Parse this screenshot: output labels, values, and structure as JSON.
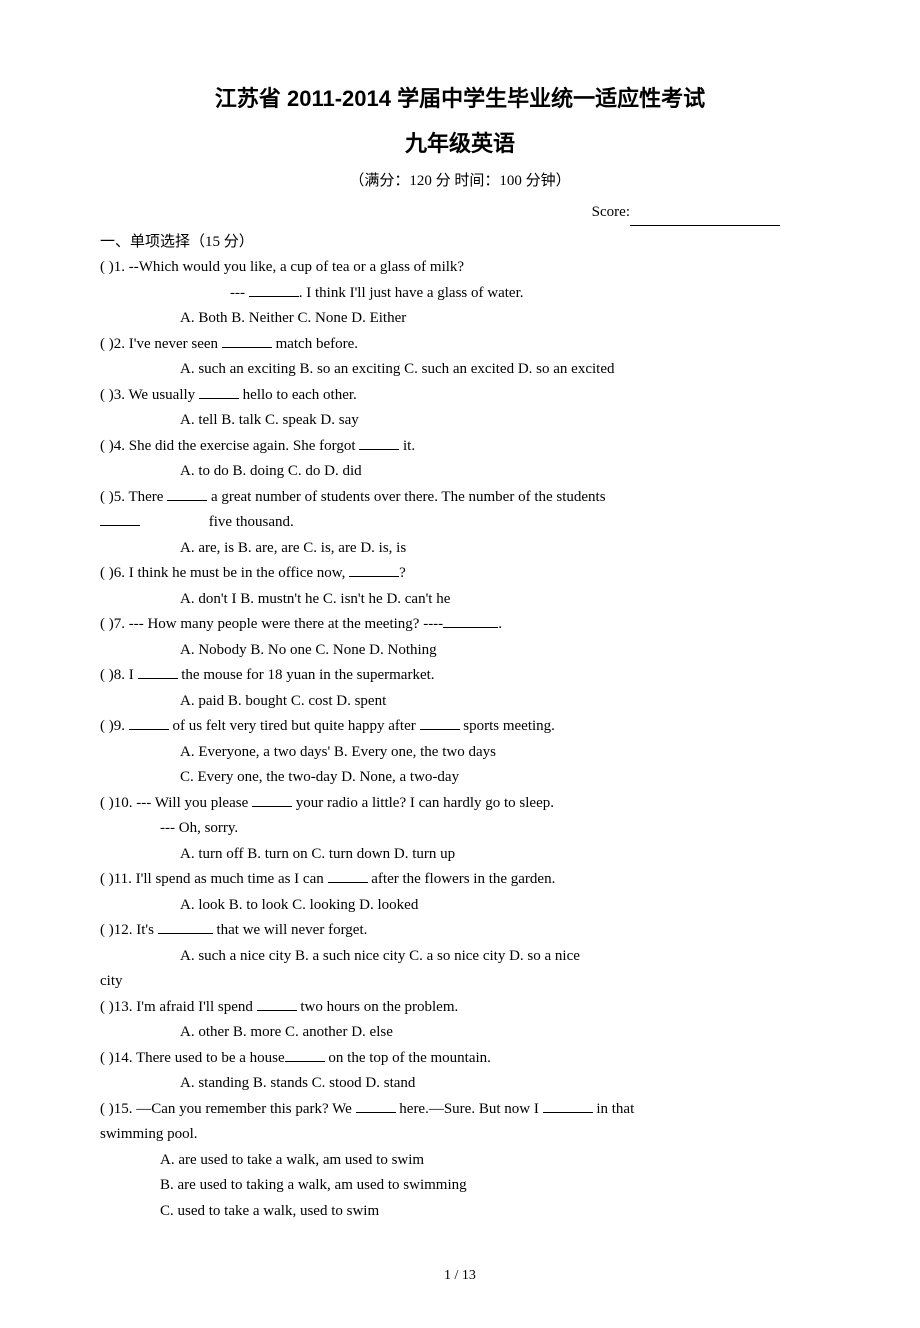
{
  "header": {
    "title1": "江苏省 2011-2014 学届中学生毕业统一适应性考试",
    "title2": "九年级英语",
    "subtitle": "（满分：120 分  时间：100 分钟）",
    "score_label": "Score:"
  },
  "section1": {
    "header": "一、单项选择（15 分）"
  },
  "q1": {
    "stem_a": "(    )1. --Which would you like, a cup of tea or a glass of milk?",
    "stem_b": "--- ",
    "stem_c": ". I think I'll just have a glass of water.",
    "opts": "A. Both    B. Neither    C. None    D. Either"
  },
  "q2": {
    "stem_a": "(    )2. I've never seen ",
    "stem_b": " match before.",
    "opts": "A. such an exciting    B. so an exciting    C. such an excited    D. so an excited"
  },
  "q3": {
    "stem_a": "(    )3. We usually ",
    "stem_b": " hello to each other.",
    "opts": "A. tell    B. talk    C. speak    D. say"
  },
  "q4": {
    "stem_a": "(    )4. She did the exercise again. She forgot ",
    "stem_b": " it.",
    "opts": "A. to do    B. doing    C. do    D. did"
  },
  "q5": {
    "stem_a": "(    )5. There ",
    "stem_b": " a great number of students over there. The number of the students",
    "cont": "  five thousand.",
    "opts": "A. are, is    B. are, are    C. is, are    D. is, is"
  },
  "q6": {
    "stem_a": "(    )6. I think he must be in the office now, ",
    "stem_b": "?",
    "opts": "A. don't I    B. mustn't he    C. isn't he    D. can't he"
  },
  "q7": {
    "stem_a": "(    )7. --- How many people were there at the meeting? ----",
    "stem_b": ".",
    "opts": "A. Nobody    B. No one    C. None    D. Nothing"
  },
  "q8": {
    "stem_a": "(    )8. I ",
    "stem_b": " the mouse for 18 yuan in the supermarket.",
    "opts": "A. paid    B. bought    C. cost    D. spent"
  },
  "q9": {
    "stem_a": "(    )9. ",
    "stem_b": " of us felt very tired but quite happy after ",
    "stem_c": " sports meeting.",
    "opts1": "A. Everyone, a two days'      B. Every one, the two days",
    "opts2": "C. Every one, the two-day    D. None, a two-day"
  },
  "q10": {
    "stem_a": "(    )10. --- Will you please ",
    "stem_b": " your radio a little? I can hardly go to sleep.",
    "cont": "--- Oh, sorry.",
    "opts": "A. turn off     B. turn on    C. turn down    D. turn up"
  },
  "q11": {
    "stem_a": "(    )11. I'll spend as much time as I can ",
    "stem_b": " after the flowers in the garden.",
    "opts": "A. look    B. to look    C. looking    D. looked"
  },
  "q12": {
    "stem_a": "(    )12. It's ",
    "stem_b": " that we will never forget.",
    "opts": "A. such a nice city     B. a such nice city    C. a so nice city   D. so a nice",
    "cont": "city"
  },
  "q13": {
    "stem_a": "(    )13. I'm afraid I'll spend ",
    "stem_b": " two hours on the problem.",
    "opts": "A. other    B. more    C. another    D. else"
  },
  "q14": {
    "stem_a": "(    )14. There used to be a house",
    "stem_b": " on the top of the mountain.",
    "opts": "A. standing     B. stands    C. stood    D. stand"
  },
  "q15": {
    "stem_a": "(    )15. —Can you remember this park? We ",
    "stem_b": " here.—Sure. But now I ",
    "stem_c": " in that",
    "cont": "swimming   pool.",
    "optA": "A. are used to take a walk, am used to swim",
    "optB": " B. are used to taking a walk, am used to swimming",
    "optC": "C. used to take a walk, used to swim"
  },
  "footer": {
    "page": "1 / 13"
  }
}
